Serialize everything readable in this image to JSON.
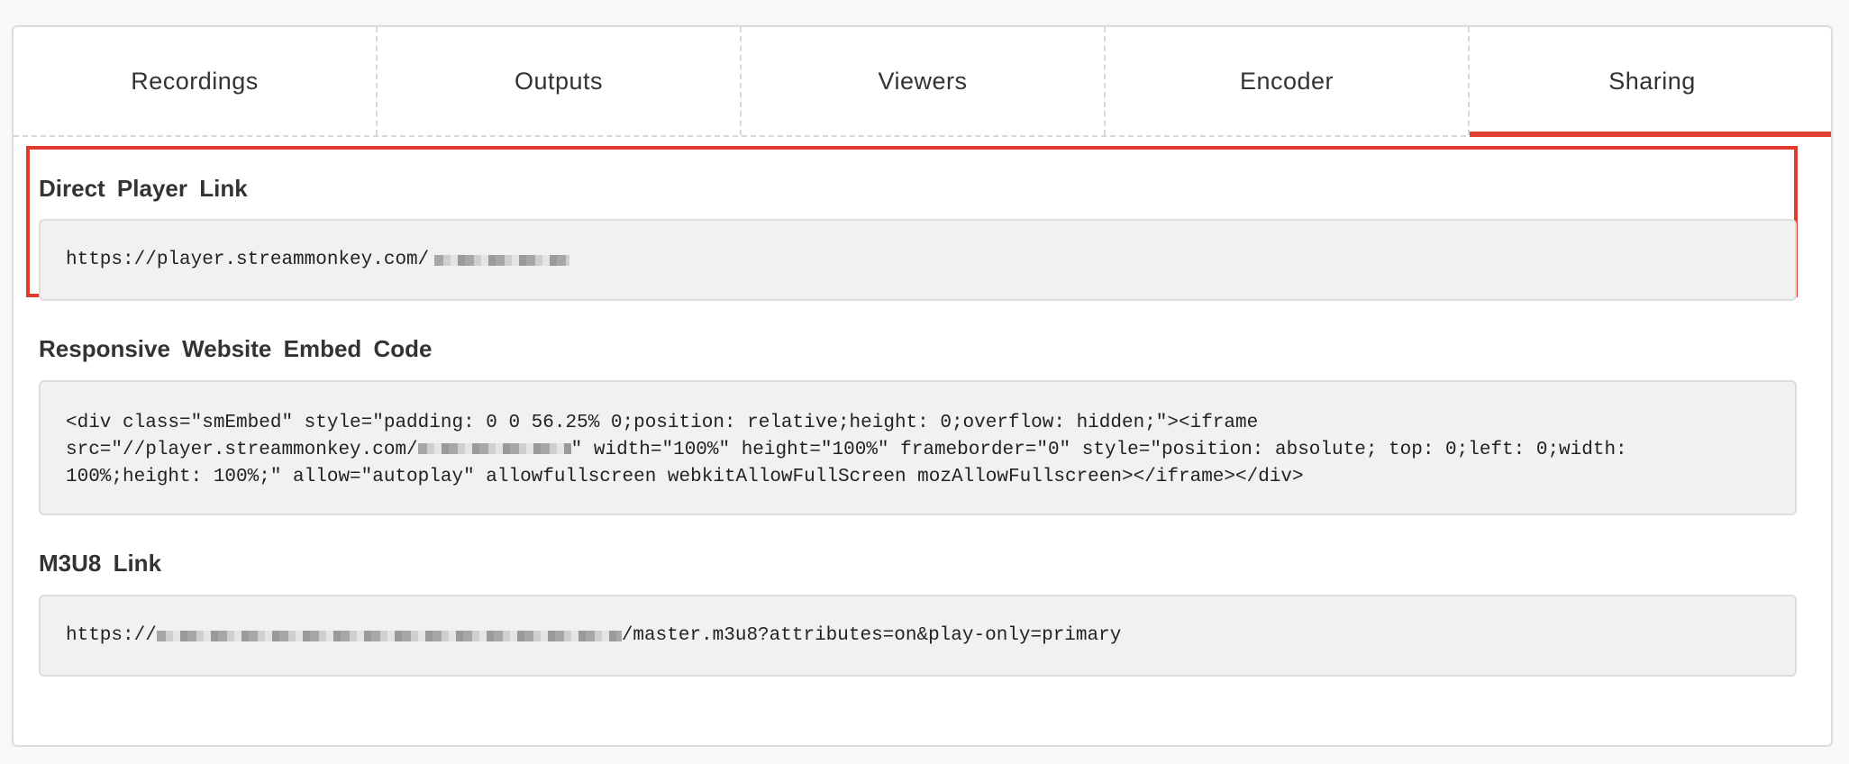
{
  "tabs": [
    {
      "label": "Recordings",
      "active": false
    },
    {
      "label": "Outputs",
      "active": false
    },
    {
      "label": "Viewers",
      "active": false
    },
    {
      "label": "Encoder",
      "active": false
    },
    {
      "label": "Sharing",
      "active": true
    }
  ],
  "colors": {
    "accent": "#e2402f",
    "highlight_border": "#e13a2f",
    "code_background": "#f1f1f1"
  },
  "sections": {
    "direct_player": {
      "title": "Direct Player Link",
      "value_prefix": "https://player.streammonkey.com/"
    },
    "embed": {
      "title": "Responsive Website Embed Code",
      "line1": "<div class=\"smEmbed\" style=\"padding: 0 0 56.25% 0;position: relative;height: 0;overflow: hidden;\"><iframe",
      "line2_prefix": "src=\"//player.streammonkey.com/",
      "line2_suffix": "\" width=\"100%\" height=\"100%\" frameborder=\"0\" style=\"position: absolute; top: 0;left: 0;width:",
      "line3": "100%;height: 100%;\" allow=\"autoplay\" allowfullscreen webkitAllowFullScreen mozAllowFullscreen></iframe></div>"
    },
    "m3u8": {
      "title": "M3U8 Link",
      "value_prefix": "https://",
      "value_suffix": "/master.m3u8?attributes=on&play-only=primary"
    }
  }
}
